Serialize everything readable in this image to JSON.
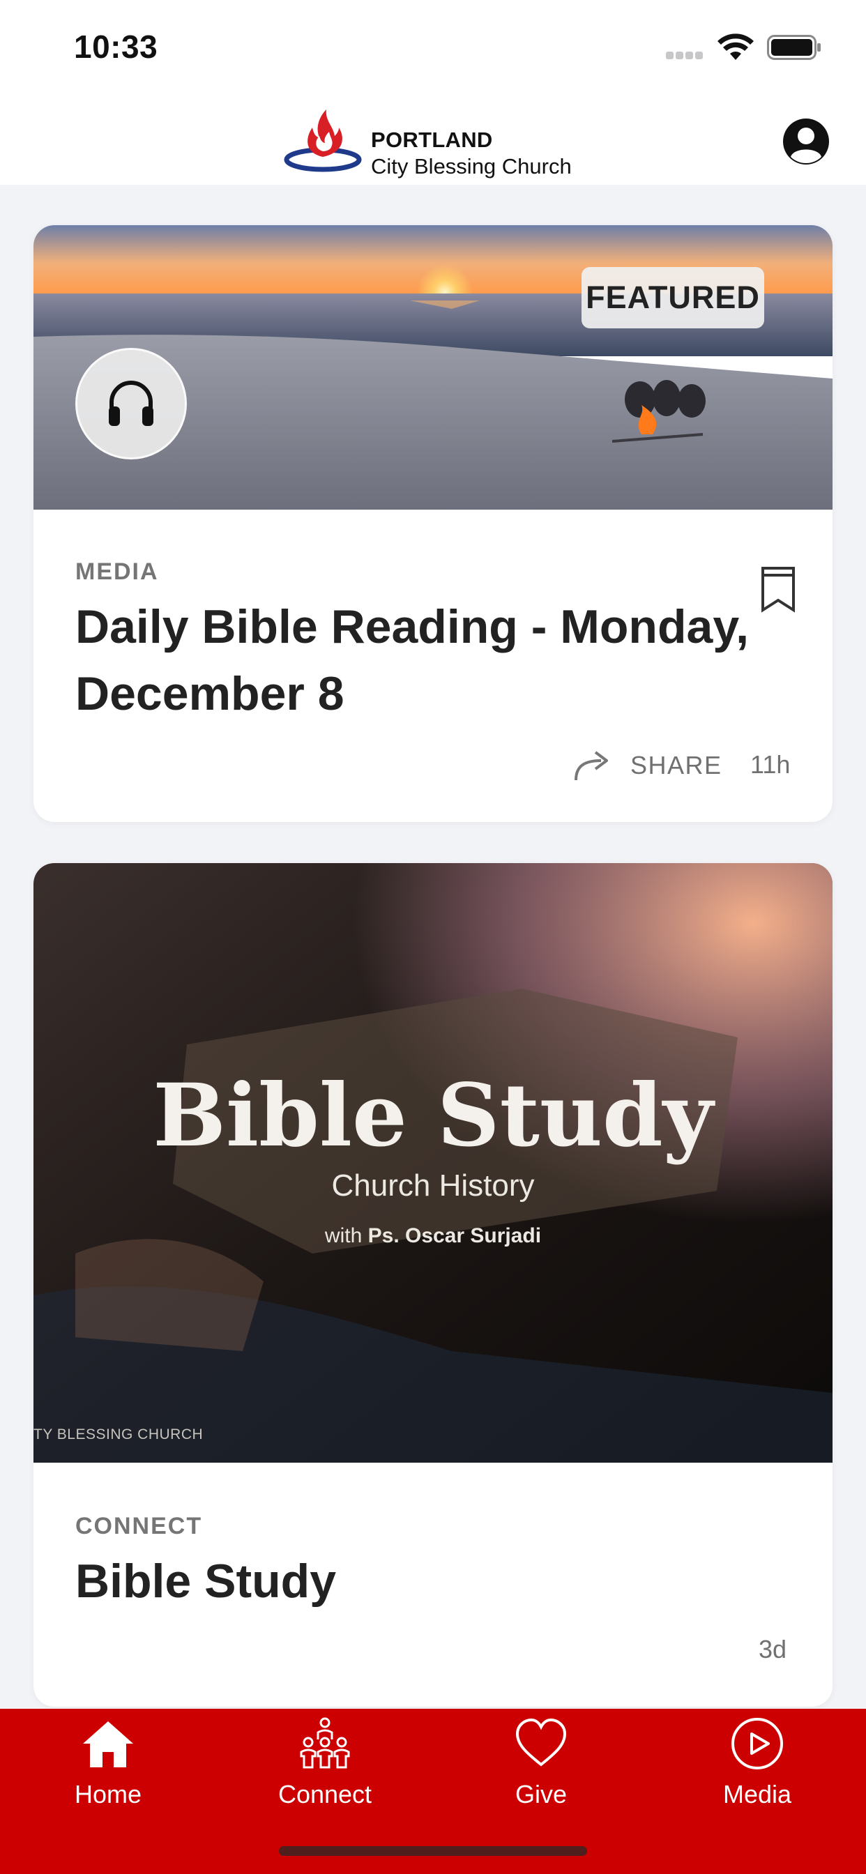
{
  "status_bar": {
    "time": "10:33"
  },
  "header": {
    "logo_line1": "PORTLAND",
    "logo_line2": "City Blessing Church",
    "profile_icon": "person-circle-icon"
  },
  "feed": [
    {
      "badge": "FEATURED",
      "media_icon": "headphones-icon",
      "category": "MEDIA",
      "title": "Daily Bible Reading - Monday, December 8",
      "share_label": "SHARE",
      "timestamp": "11h"
    },
    {
      "poster": {
        "title": "Bible Study",
        "subtitle": "Church History",
        "with_prefix": "with",
        "with_name": "Ps. Oscar Surjadi",
        "watermark": "TY BLESSING CHURCH"
      },
      "category": "CONNECT",
      "title": "Bible Study",
      "timestamp": "3d"
    }
  ],
  "tab_bar": {
    "tabs": [
      {
        "label": "Home",
        "icon": "home-icon"
      },
      {
        "label": "Connect",
        "icon": "people-icon"
      },
      {
        "label": "Give",
        "icon": "heart-icon"
      },
      {
        "label": "Media",
        "icon": "play-circle-icon"
      }
    ]
  },
  "colors": {
    "brand_red": "#cc0000",
    "logo_blue": "#1f3a8a",
    "background": "#f2f3f7"
  }
}
